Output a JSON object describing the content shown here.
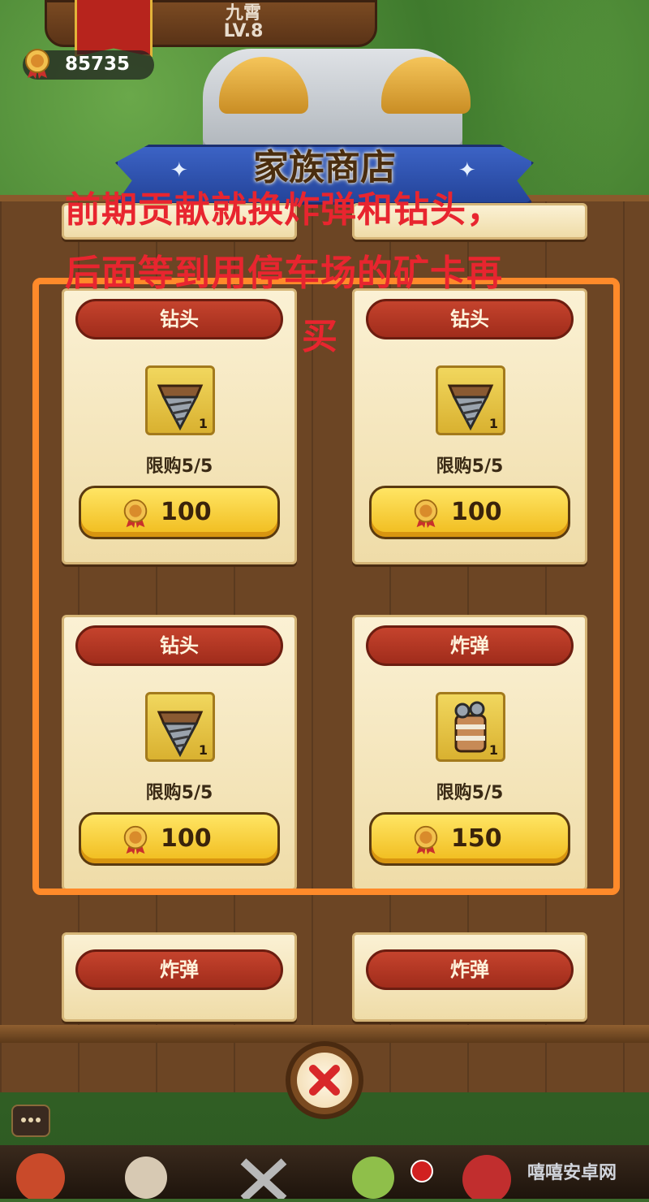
{
  "player": {
    "name": "九霄",
    "level": "LV.8"
  },
  "currency": {
    "icon": "contribution-medal-icon",
    "value": "85735"
  },
  "shop": {
    "title": "家族商店",
    "items": [
      {
        "name": "钻头",
        "icon": "drill-icon",
        "count": "1",
        "limit": "限购5/5",
        "price": "100"
      },
      {
        "name": "钻头",
        "icon": "drill-icon",
        "count": "1",
        "limit": "限购5/5",
        "price": "100"
      },
      {
        "name": "钻头",
        "icon": "drill-icon",
        "count": "1",
        "limit": "限购5/5",
        "price": "100"
      },
      {
        "name": "炸弹",
        "icon": "bomb-icon",
        "count": "1",
        "limit": "限购5/5",
        "price": "150"
      },
      {
        "name": "炸弹",
        "icon": "bomb-icon"
      },
      {
        "name": "炸弹",
        "icon": "bomb-icon"
      }
    ],
    "close_icon": "close-x-icon"
  },
  "annotation": {
    "line1": "前期贡献就换炸弹和钻头，",
    "line2": "后面等到用停车场的矿卡再",
    "line3": "买",
    "color": "#e8252f",
    "box_color": "#ff8a2a"
  },
  "watermark": "嘻嘻安卓网"
}
